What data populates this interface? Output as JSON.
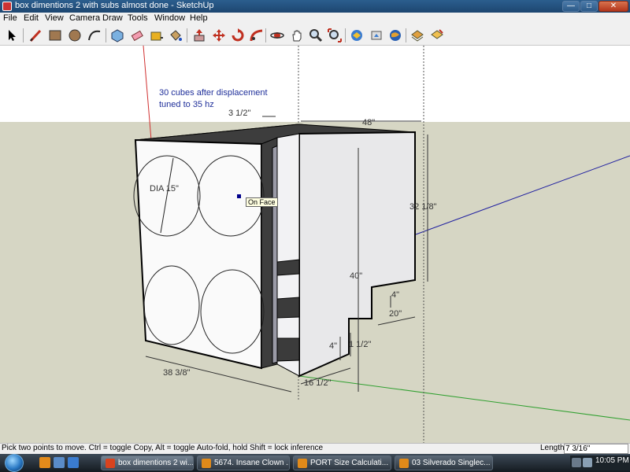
{
  "window": {
    "title": "box dimentions 2 with subs almost done - SketchUp",
    "minimize_label": "—",
    "maximize_label": "□",
    "close_label": "✕"
  },
  "menu": {
    "items": [
      "File",
      "Edit",
      "View",
      "Camera",
      "Draw",
      "Tools",
      "Window",
      "Help"
    ]
  },
  "toolbar": {
    "tools": [
      "select-tool-icon",
      "line-tool-icon",
      "rectangle-tool-icon",
      "circle-tool-icon",
      "arc-tool-icon",
      "make-component-icon",
      "eraser-icon",
      "tape-measure-icon",
      "paint-bucket-icon",
      "push-pull-icon",
      "move-icon",
      "rotate-icon",
      "follow-me-icon",
      "offset-icon",
      "orbit-icon",
      "pan-icon",
      "zoom-icon",
      "zoom-extents-icon",
      "get-models-icon",
      "share-model-icon",
      "google-earth-icon",
      "get-photo-texture-icon",
      "components-icon"
    ]
  },
  "scene": {
    "note_line1": "30 cubes after displacement",
    "note_line2": "tuned to 35 hz",
    "dimensions": {
      "top_gap": "3 1/2\"",
      "width": "48\"",
      "height_right": "32 1/8\"",
      "height_main": "40\"",
      "port_4_top": "4\"",
      "port_20": "20\"",
      "port_1_1_2": "1 1/2\"",
      "port_4_side": "4\"",
      "bottom_16_1_2": "16 1/2\"",
      "depth": "38 3/8\"",
      "diameter": "DIA 15\""
    },
    "tooltip": "On Face"
  },
  "status": {
    "hint": "Pick two points to move.  Ctrl = toggle Copy, Alt = toggle Auto-fold, hold Shift = lock inference",
    "measure_label": "Length",
    "measure_value": "7 3/16\""
  },
  "taskbar": {
    "windows": [
      {
        "label": "box dimentions 2 wi...",
        "icon_color": "#d9431e"
      },
      {
        "label": "5674. Insane Clown ...",
        "icon_color": "#e08a1a"
      },
      {
        "label": "PORT Size Calculati...",
        "icon_color": "#e08a1a"
      },
      {
        "label": "03 Silverado Singlec...",
        "icon_color": "#e08a1a"
      }
    ],
    "clock": "10:05 PM"
  }
}
